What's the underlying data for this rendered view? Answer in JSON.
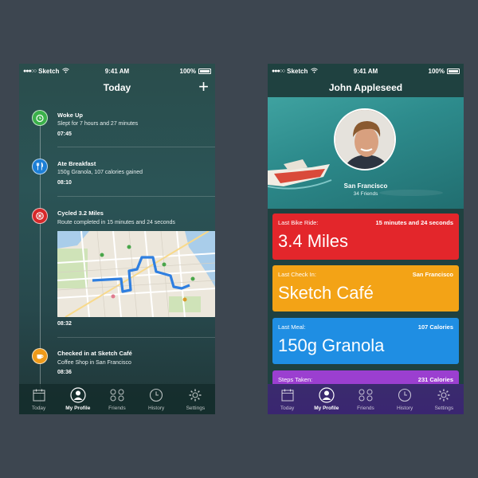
{
  "status": {
    "carrier": "Sketch",
    "time": "9:41 AM",
    "battery": "100%"
  },
  "left": {
    "title": "Today",
    "add_label": "+",
    "timeline": [
      {
        "title": "Woke Up",
        "subtitle": "Slept for 7 hours and 27 minutes",
        "time": "07:45",
        "icon": "alarm-clock-icon",
        "color": "#3ab04a"
      },
      {
        "title": "Ate Breakfast",
        "subtitle": "150g Granola, 107 calories gained",
        "time": "08:10",
        "icon": "fork-knife-icon",
        "color": "#1c7fd6"
      },
      {
        "title": "Cycled 3.2 Miles",
        "subtitle": "Route completed in 15 minutes and 24 seconds",
        "time": "08:32",
        "icon": "bike-wheel-icon",
        "color": "#d6282a"
      },
      {
        "title": "Checked in at Sketch Café",
        "subtitle": "Coffee Shop in San Francisco",
        "time": "08:36",
        "icon": "coffee-cup-icon",
        "color": "#ee9a1a"
      }
    ]
  },
  "right": {
    "title": "John Appleseed",
    "city": "San Francisco",
    "friends": "34 Friends",
    "cards": [
      {
        "label": "Last Bike Ride:",
        "meta": "15 minutes and 24 seconds",
        "value": "3.4 Miles",
        "color": "#e3262b"
      },
      {
        "label": "Last Check In:",
        "meta": "San Francisco",
        "value": "Sketch Café",
        "color": "#f3a316"
      },
      {
        "label": "Last Meal:",
        "meta": "107 Calories",
        "value": "150g Granola",
        "color": "#1f8ee3"
      },
      {
        "label": "Steps Taken:",
        "meta": "231 Calories",
        "value": "",
        "color": "#9b3fd0"
      }
    ]
  },
  "tabs": [
    "Today",
    "My Profile",
    "Friends",
    "History",
    "Settings"
  ]
}
